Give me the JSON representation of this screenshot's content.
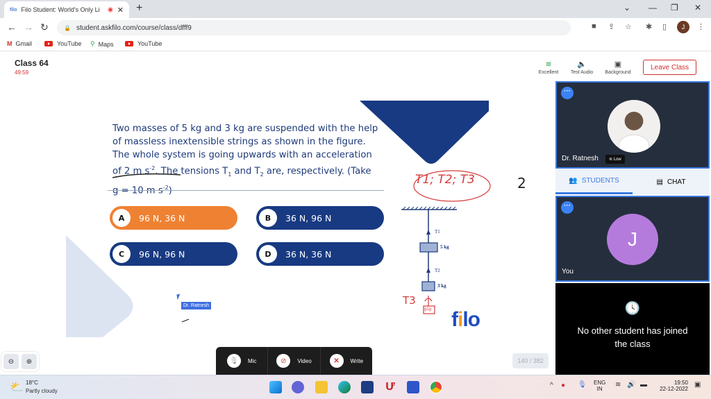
{
  "browser": {
    "tab_favicon": "filo",
    "tab_title": "Filo Student: World's Only Li",
    "new_tab": "+",
    "url": "student.askfilo.com/course/class/dfff9",
    "profile_initial": "J",
    "bookmarks": [
      {
        "label": "Gmail",
        "icon": "gmail-icon"
      },
      {
        "label": "YouTube",
        "icon": "youtube-icon"
      },
      {
        "label": "Maps",
        "icon": "maps-icon"
      },
      {
        "label": "YouTube",
        "icon": "youtube-icon"
      }
    ]
  },
  "class_header": {
    "title": "Class 64",
    "timer": "49:59",
    "tools": [
      {
        "label": "Excellent",
        "icon": "wifi-icon"
      },
      {
        "label": "Test Audio",
        "icon": "speaker-icon"
      },
      {
        "label": "Background",
        "icon": "background-icon"
      }
    ],
    "leave_label": "Leave Class"
  },
  "question": {
    "line1": "Two masses of 5 kg and 3 kg are suspended with the help",
    "line2": "of massless inextensible strings as shown in the figure.",
    "line3": "The whole system is going upwards with an acceleration",
    "line4_a": "of 2 m s",
    "line4_b": "-2",
    "line4_c": ". The tensions T",
    "line4_d": "1",
    "line4_e": " and T",
    "line4_f": "2",
    "line4_g": " are, respectively. (Take",
    "line5_a": "g = 10 m s",
    "line5_b": "-2",
    "line5_c": ")",
    "options": [
      {
        "letter": "A",
        "text": "96 N, 36 N",
        "selected": true
      },
      {
        "letter": "B",
        "text": "36 N, 96 N",
        "selected": false
      },
      {
        "letter": "C",
        "text": "96 N, 96 N",
        "selected": false
      },
      {
        "letter": "D",
        "text": "36 N, 36 N",
        "selected": false
      }
    ]
  },
  "figure": {
    "t1": "T1",
    "t2": "T2",
    "m1": "5 kg",
    "m2": "3 kg"
  },
  "annotations": {
    "circled": "T1; T2; T3",
    "number": "2",
    "t3": "T3",
    "weight": "g1g"
  },
  "brand": {
    "logo_a": "f",
    "logo_dot": "i",
    "logo_b": "lo"
  },
  "cursor_label": "Dr. Ratnesh",
  "media_controls": [
    {
      "label": "Mic",
      "icon": "mic-icon"
    },
    {
      "label": "Video",
      "icon": "video-off-icon"
    },
    {
      "label": "Write",
      "icon": "write-off-icon"
    }
  ],
  "page_counter": "140 / 382",
  "participants": {
    "teacher_name": "Dr. Ratnesh",
    "teacher_signal": "Low",
    "you_initial": "J",
    "you_name": "You",
    "tabs": [
      {
        "label": "STUDENTS",
        "active": true
      },
      {
        "label": "CHAT",
        "active": false
      }
    ],
    "empty_message": "No other student has joined the class"
  },
  "taskbar": {
    "weather_temp": "18°C",
    "weather_desc": "Partly cloudy",
    "lang_line1": "ENG",
    "lang_line2": "IN",
    "time": "19:50",
    "date": "22-12-2022"
  },
  "colors": {
    "accent_blue": "#183a82",
    "selected_orange": "#ef8132",
    "leave_red": "#d32f2f",
    "you_avatar": "#b57bdc"
  }
}
